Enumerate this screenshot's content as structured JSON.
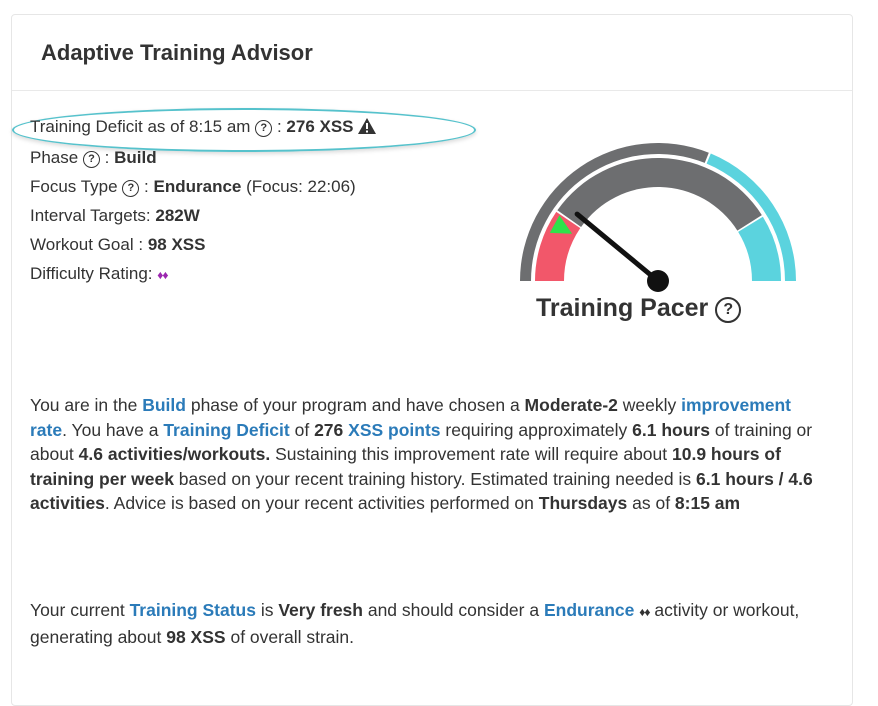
{
  "header": {
    "title": "Adaptive Training Advisor"
  },
  "summary": {
    "deficit_label": "Training Deficit as of 8:15 am",
    "deficit_value": "276 XSS",
    "phase_label": "Phase",
    "phase_value": "Build",
    "focus_label": "Focus Type",
    "focus_value": "Endurance",
    "focus_extra": "(Focus: 22:06)",
    "interval_label": "Interval Targets:",
    "interval_value": "282W",
    "goal_label": "Workout Goal :",
    "goal_value": "98 XSS",
    "difficulty_label": "Difficulty Rating:",
    "difficulty_value": "♦♦",
    "separator": ":",
    "help_glyph": "?"
  },
  "pacer": {
    "label": "Training Pacer",
    "colors": {
      "gray": "#6d6e70",
      "red": "#f2576a",
      "cyan": "#5bd3de",
      "marker": "#2ee24a",
      "needle": "#111111"
    },
    "needle_value_fraction": 0.22,
    "target_marker_fraction": 0.16
  },
  "advice": {
    "p1": {
      "t1": "You are in the ",
      "build": "Build",
      "t2": " phase of your program and have chosen a ",
      "rate": "Moderate-2",
      "t3": " weekly ",
      "improvement_rate": "improvement rate",
      "t4": ". You have a ",
      "training_deficit": "Training Deficit",
      "t5": " of ",
      "deficit_num": "276",
      "t6": " ",
      "xss": "XSS",
      "t7": " ",
      "points": "points",
      "t8": " requiring approximately ",
      "hours": "6.1 hours",
      "t9": " of training or about ",
      "activities": "4.6 activities/workouts.",
      "t10": " Sustaining this improvement rate will require about ",
      "per_week": "10.9 hours of training per week",
      "t11": " based on your recent training history. Estimated training needed is ",
      "estimated": "6.1 hours / 4.6 activities",
      "t12": ". Advice is based on your recent activities performed on ",
      "day": "Thursdays",
      "t13": " as of ",
      "time": "8:15 am"
    },
    "p2": {
      "t1": "Your current ",
      "status_label": "Training Status",
      "t2": " is ",
      "status": "Very fresh",
      "t3": " and should consider a ",
      "endurance": "Endurance",
      "diamonds": "♦♦",
      "t4": " activity or workout, generating about ",
      "xss": "98 XSS",
      "t5": " of overall strain."
    }
  }
}
